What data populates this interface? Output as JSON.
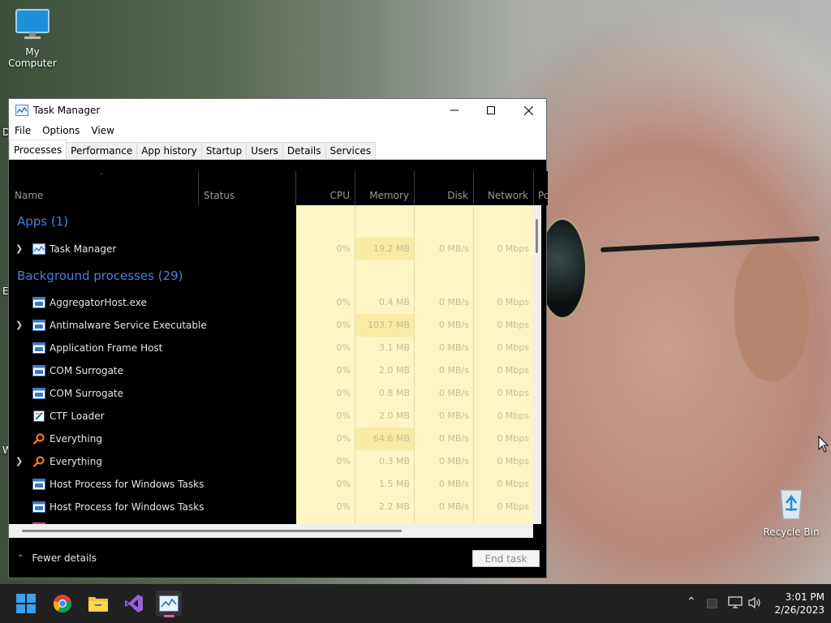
{
  "desktop": {
    "icons": [
      {
        "label": "My Computer"
      },
      {
        "label": "Recycle Bin"
      }
    ],
    "edge_letters": [
      "D",
      "E",
      "W"
    ]
  },
  "window": {
    "title": "Task Manager",
    "menu": [
      "File",
      "Options",
      "View"
    ],
    "tabs": [
      "Processes",
      "Performance",
      "App history",
      "Startup",
      "Users",
      "Details",
      "Services"
    ],
    "active_tab": "Processes",
    "columns": {
      "name": "Name",
      "status": "Status",
      "cpu": "CPU",
      "memory": "Memory",
      "disk": "Disk",
      "network": "Network",
      "power": "Po"
    },
    "groups": {
      "apps": "Apps (1)",
      "background": "Background processes (29)"
    },
    "apps": [
      {
        "name": "Task Manager",
        "cpu": "0%",
        "memory": "19.2 MB",
        "disk": "0 MB/s",
        "network": "0 Mbps"
      }
    ],
    "background": [
      {
        "name": "AggregatorHost.exe",
        "cpu": "0%",
        "memory": "0.4 MB",
        "disk": "0 MB/s",
        "network": "0 Mbps"
      },
      {
        "name": "Antimalware Service Executable",
        "cpu": "0%",
        "memory": "103.7 MB",
        "disk": "0 MB/s",
        "network": "0 Mbps"
      },
      {
        "name": "Application Frame Host",
        "cpu": "0%",
        "memory": "3.1 MB",
        "disk": "0 MB/s",
        "network": "0 Mbps"
      },
      {
        "name": "COM Surrogate",
        "cpu": "0%",
        "memory": "2.0 MB",
        "disk": "0 MB/s",
        "network": "0 Mbps"
      },
      {
        "name": "COM Surrogate",
        "cpu": "0%",
        "memory": "0.8 MB",
        "disk": "0 MB/s",
        "network": "0 Mbps"
      },
      {
        "name": "CTF Loader",
        "cpu": "0%",
        "memory": "2.0 MB",
        "disk": "0 MB/s",
        "network": "0 Mbps"
      },
      {
        "name": "Everything",
        "cpu": "0%",
        "memory": "64.6 MB",
        "disk": "0 MB/s",
        "network": "0 Mbps"
      },
      {
        "name": "Everything",
        "cpu": "0%",
        "memory": "0.3 MB",
        "disk": "0 MB/s",
        "network": "0 Mbps"
      },
      {
        "name": "Host Process for Windows Tasks",
        "cpu": "0%",
        "memory": "1.5 MB",
        "disk": "0 MB/s",
        "network": "0 Mbps"
      },
      {
        "name": "Host Process for Windows Tasks",
        "cpu": "0%",
        "memory": "2.2 MB",
        "disk": "0 MB/s",
        "network": "0 Mbps"
      }
    ],
    "footer": {
      "fewer_details": "Fewer details",
      "end_task": "End task"
    }
  },
  "taskbar": {
    "time": "3:01 PM",
    "date": "2/26/2023"
  },
  "colors": {
    "group_title": "#4a7fd8",
    "cell_bg": "#fff4c4",
    "taskbar": "#202020"
  }
}
